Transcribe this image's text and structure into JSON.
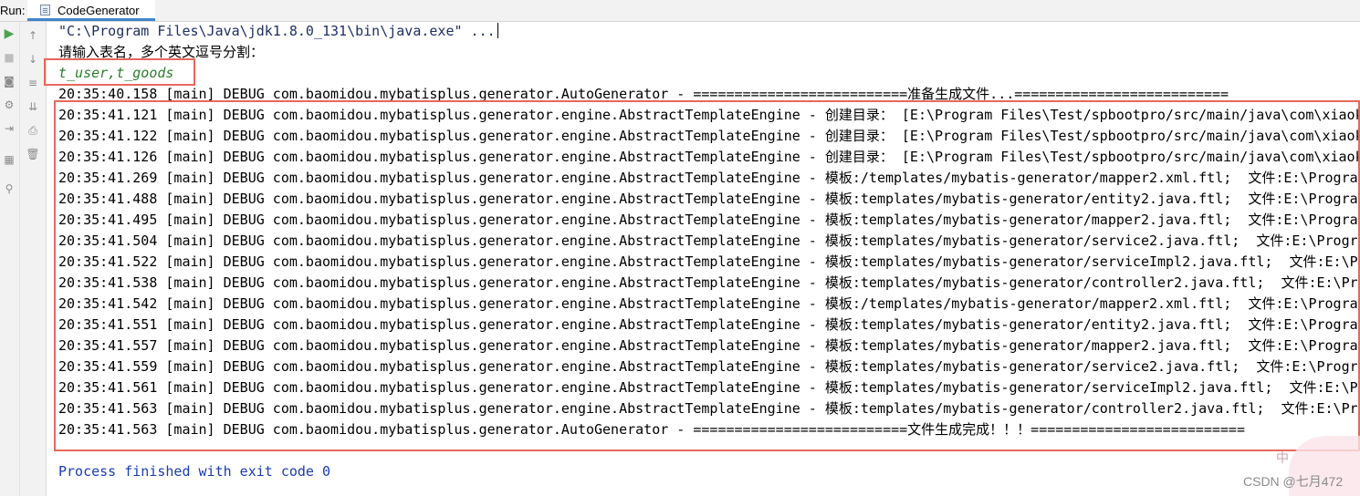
{
  "tabbar": {
    "run_label": "Run:",
    "tab_title": "CodeGenerator"
  },
  "icons": {
    "run": "play-icon",
    "stop": "stop-icon",
    "up": "arrow-up-icon",
    "down": "arrow-down-icon",
    "camera": "camera-icon",
    "wrap": "soft-wrap-icon",
    "settings": "settings-icon",
    "scroll": "scroll-to-end-icon",
    "login": "restore-layout-icon",
    "print": "print-icon",
    "layout": "layout-icon",
    "delete": "trash-icon",
    "pin": "pin-icon"
  },
  "console": {
    "command": "\"C:\\Program Files\\Java\\jdk1.8.0_131\\bin\\java.exe\" ...",
    "prompt": "请输入表名，多个英文逗号分割：",
    "input": "t_user,t_goods",
    "log_lines": [
      "20:35:40.158 [main] DEBUG com.baomidou.mybatisplus.generator.AutoGenerator - ==========================准备生成文件...==========================",
      "20:35:41.121 [main] DEBUG com.baomidou.mybatisplus.generator.engine.AbstractTemplateEngine - 创建目录： [E:\\Program Files\\Test/spbootpro/src/main/java\\com\\xiaok",
      "20:35:41.122 [main] DEBUG com.baomidou.mybatisplus.generator.engine.AbstractTemplateEngine - 创建目录： [E:\\Program Files\\Test/spbootpro/src/main/java\\com\\xiaok",
      "20:35:41.126 [main] DEBUG com.baomidou.mybatisplus.generator.engine.AbstractTemplateEngine - 创建目录： [E:\\Program Files\\Test/spbootpro/src/main/java\\com\\xiaok",
      "20:35:41.269 [main] DEBUG com.baomidou.mybatisplus.generator.engine.AbstractTemplateEngine - 模板:/templates/mybatis-generator/mapper2.xml.ftl;  文件:E:\\Progra",
      "20:35:41.488 [main] DEBUG com.baomidou.mybatisplus.generator.engine.AbstractTemplateEngine - 模板:templates/mybatis-generator/entity2.java.ftl;  文件:E:\\Progra",
      "20:35:41.495 [main] DEBUG com.baomidou.mybatisplus.generator.engine.AbstractTemplateEngine - 模板:templates/mybatis-generator/mapper2.java.ftl;  文件:E:\\Progra",
      "20:35:41.504 [main] DEBUG com.baomidou.mybatisplus.generator.engine.AbstractTemplateEngine - 模板:templates/mybatis-generator/service2.java.ftl;  文件:E:\\Progra",
      "20:35:41.522 [main] DEBUG com.baomidou.mybatisplus.generator.engine.AbstractTemplateEngine - 模板:templates/mybatis-generator/serviceImpl2.java.ftl;  文件:E:\\Pr",
      "20:35:41.538 [main] DEBUG com.baomidou.mybatisplus.generator.engine.AbstractTemplateEngine - 模板:templates/mybatis-generator/controller2.java.ftl;  文件:E:\\Pro",
      "20:35:41.542 [main] DEBUG com.baomidou.mybatisplus.generator.engine.AbstractTemplateEngine - 模板:/templates/mybatis-generator/mapper2.xml.ftl;  文件:E:\\Progra",
      "20:35:41.551 [main] DEBUG com.baomidou.mybatisplus.generator.engine.AbstractTemplateEngine - 模板:templates/mybatis-generator/entity2.java.ftl;  文件:E:\\Progra",
      "20:35:41.557 [main] DEBUG com.baomidou.mybatisplus.generator.engine.AbstractTemplateEngine - 模板:templates/mybatis-generator/mapper2.java.ftl;  文件:E:\\Progra",
      "20:35:41.559 [main] DEBUG com.baomidou.mybatisplus.generator.engine.AbstractTemplateEngine - 模板:templates/mybatis-generator/service2.java.ftl;  文件:E:\\Progra",
      "20:35:41.561 [main] DEBUG com.baomidou.mybatisplus.generator.engine.AbstractTemplateEngine - 模板:templates/mybatis-generator/serviceImpl2.java.ftl;  文件:E:\\Pr",
      "20:35:41.563 [main] DEBUG com.baomidou.mybatisplus.generator.engine.AbstractTemplateEngine - 模板:templates/mybatis-generator/controller2.java.ftl;  文件:E:\\Pro",
      "20:35:41.563 [main] DEBUG com.baomidou.mybatisplus.generator.AutoGenerator - ==========================文件生成完成！！！=========================="
    ],
    "process_finished": "Process finished with exit code 0"
  },
  "watermark": {
    "text": "CSDN @七月472",
    "sticker_text": "中"
  },
  "colors": {
    "highlight_box": "#e8675c",
    "input_text": "#2b7d2b",
    "process_text": "#1a3cb0"
  }
}
